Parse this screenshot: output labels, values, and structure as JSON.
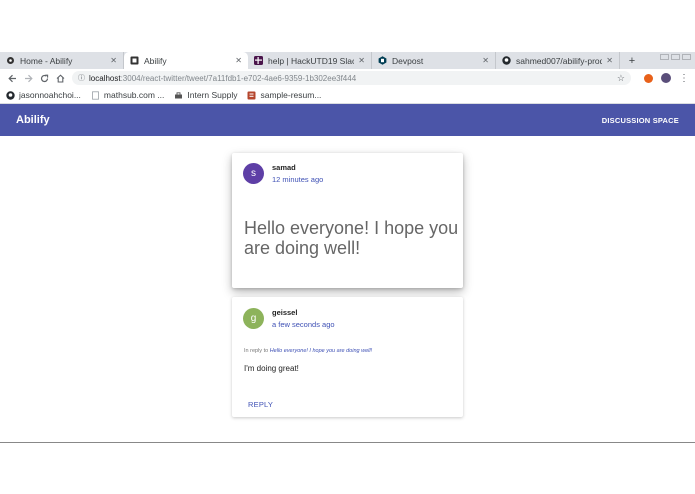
{
  "browser": {
    "tabs": [
      {
        "title": "Home - Abilify",
        "icon": "abilify-icon",
        "active": false
      },
      {
        "title": "Abilify",
        "icon": "abilify-icon",
        "active": true
      },
      {
        "title": "help | HackUTD19 Slack",
        "icon": "slack-icon",
        "active": false
      },
      {
        "title": "Devpost",
        "icon": "devpost-icon",
        "active": false
      },
      {
        "title": "sahmed007/abilify-prod",
        "icon": "github-icon",
        "active": false
      }
    ],
    "new_tab_glyph": "+",
    "url_host": "localhost",
    "url_path": ":3004/react-twitter/tweet/7a11fdb1-e702-4ae6-9359-1b302ee3f444",
    "bookmarks": [
      {
        "label": "jasonnoahchoi...",
        "icon": "github-icon"
      },
      {
        "label": "mathsub.com ...",
        "icon": "page-icon"
      },
      {
        "label": "Intern Supply",
        "icon": "intern-supply-icon"
      },
      {
        "label": "sample-resum...",
        "icon": "resume-icon"
      }
    ]
  },
  "app": {
    "brand": "Abilify",
    "nav_link": "DISCUSSION SPACE",
    "accent_color": "#4b55a8"
  },
  "tweet": {
    "avatar_letter": "s",
    "author": "samad",
    "time": "12 minutes ago",
    "text": "Hello everyone! I hope you are doing well!"
  },
  "reply": {
    "avatar_letter": "g",
    "author": "geissel",
    "time": "a few seconds ago",
    "in_reply_prefix": "In reply to",
    "in_reply_text": "Hello everyone! I hope you are doing well!",
    "text": "I'm doing great!",
    "reply_button": "REPLY"
  }
}
